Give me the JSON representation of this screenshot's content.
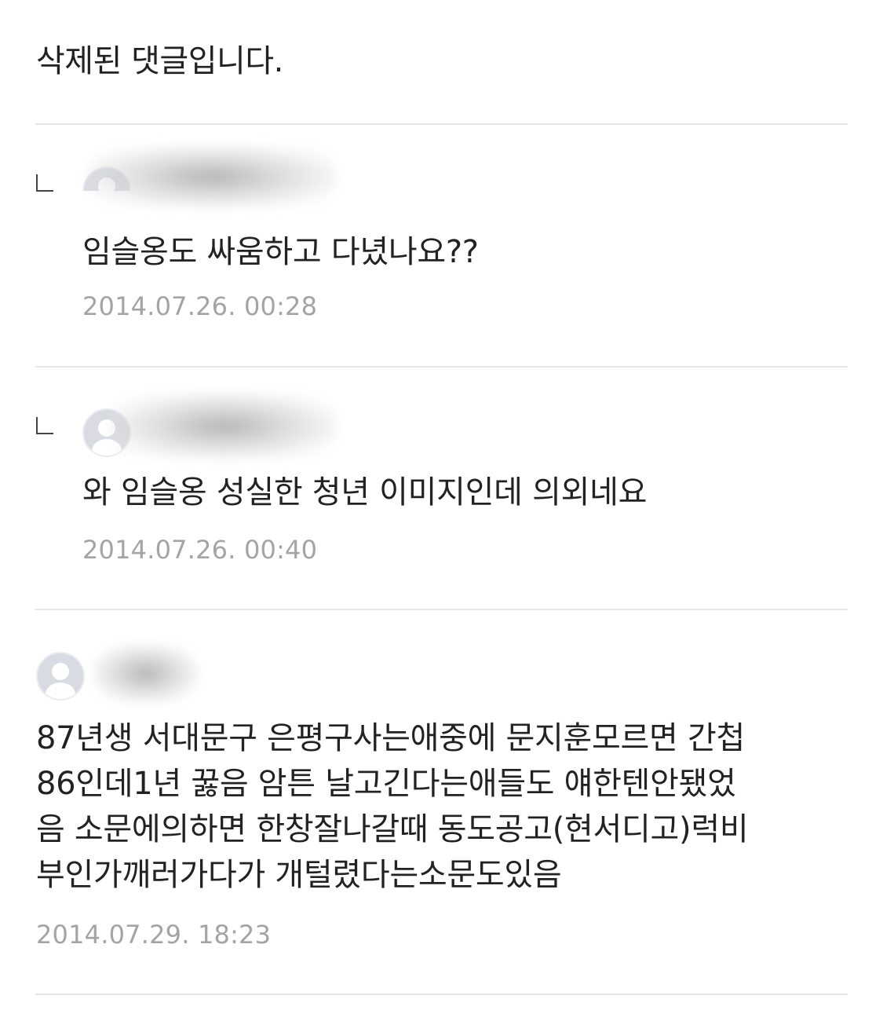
{
  "deleted_comment": {
    "text": "삭제된 댓글입니다."
  },
  "comments": [
    {
      "is_reply": true,
      "author_hidden": true,
      "text": "임슬옹도 싸움하고 다녔나요??",
      "timestamp": "2014.07.26. 00:28"
    },
    {
      "is_reply": true,
      "author_hidden": true,
      "text": "와 임슬옹 성실한 청년 이미지인데 의외네요",
      "timestamp": "2014.07.26. 00:40"
    },
    {
      "is_reply": false,
      "author_hidden": true,
      "text_lines": [
        "87년생 서대문구 은평구사는애중에 문지훈모르면 간첩",
        "86인데1년 꿇음 암튼 날고긴다는애들도 얘한텐안됐었",
        "음 소문에의하면 한창잘나갈때 동도공고(현서디고)럭비",
        "부인가깨러가다가 개털렸다는소문도있음"
      ],
      "timestamp": "2014.07.29. 18:23"
    }
  ],
  "icons": {
    "avatar": "default-avatar-icon",
    "reply": "reply-corner-icon"
  },
  "colors": {
    "text": "#222222",
    "timestamp": "#a4a4a4",
    "divider": "#e6e6e6",
    "avatar_bg": "#d9dbe3"
  }
}
